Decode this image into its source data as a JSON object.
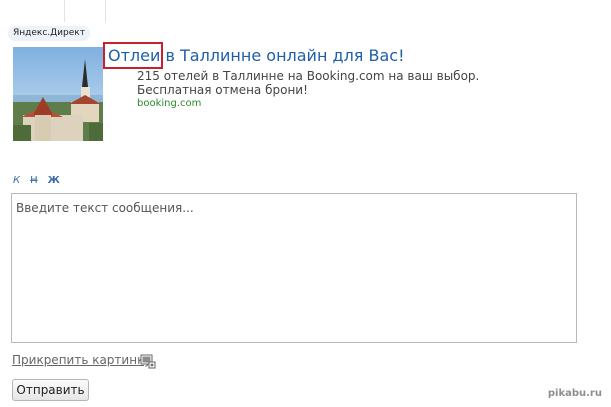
{
  "ad": {
    "label": "Яндекс.Директ",
    "title_highlighted": "Отлеи",
    "title_rest": " в Таллинне онлайн для Вас!",
    "text": "215 отелей в Таллинне на Booking.com на ваш выбор. Бесплатная отмена брони!",
    "domain": "booking.com",
    "image": "tallinn-old-town-photo",
    "highlight_color": "#c8202d"
  },
  "editor": {
    "format_italic": "К",
    "format_strike": "Н",
    "format_bold": "Ж",
    "placeholder": "Введите текст сообщения...",
    "value": ""
  },
  "actions": {
    "attach_label": "Прикрепить картинку",
    "attach_icon": "image-attach-icon",
    "send_label": "Отправить"
  },
  "watermark": "pikabu.ru",
  "colors": {
    "link": "#1f5fa8",
    "domain": "#2c8a2c",
    "format": "#3a6ea5"
  }
}
